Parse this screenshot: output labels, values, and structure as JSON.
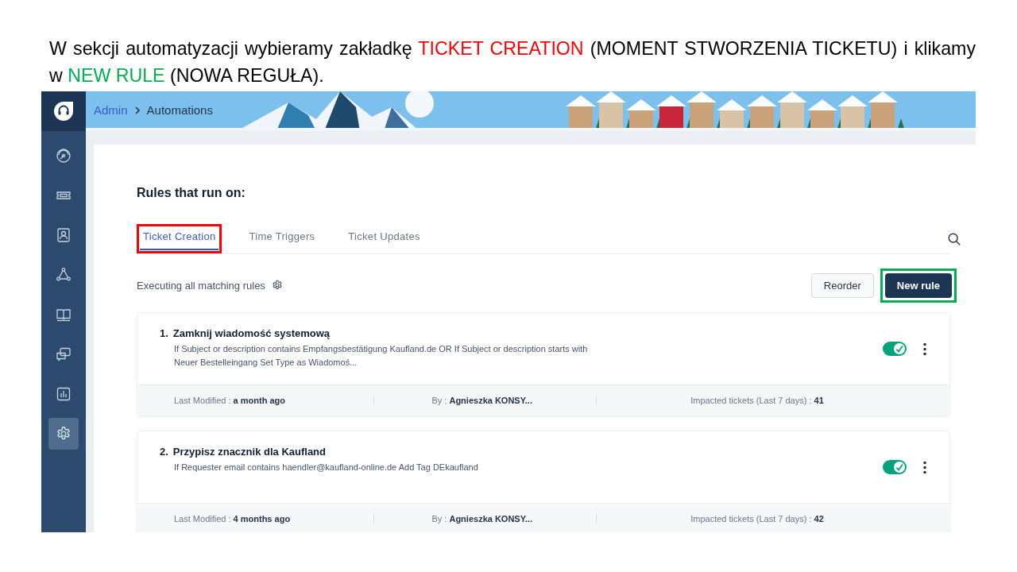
{
  "caption": {
    "segments": [
      {
        "text": "W sekcji automatyzacji wybieramy zakładkę ",
        "color": "#000000"
      },
      {
        "text": "TICKET CREATION",
        "color": "#ff0000"
      },
      {
        "text": " (MOMENT STWORZENIA TICKETU)  i klikamy w ",
        "color": "#000000"
      },
      {
        "text": "NEW RULE",
        "color": "#00b050"
      },
      {
        "text": " (NOWA REGUŁA).",
        "color": "#000000"
      }
    ]
  },
  "breadcrumb": {
    "parent": "Admin",
    "current": "Automations"
  },
  "sidebar": {
    "items": [
      {
        "selected": false
      },
      {
        "selected": false
      },
      {
        "selected": false
      },
      {
        "selected": false
      },
      {
        "selected": false
      },
      {
        "selected": false
      },
      {
        "selected": false
      },
      {
        "selected": true
      }
    ]
  },
  "heading": "Rules that run on:",
  "tabs": [
    {
      "label": "Ticket Creation",
      "selected": true
    },
    {
      "label": "Time Triggers",
      "selected": false
    },
    {
      "label": "Ticket Updates",
      "selected": false
    }
  ],
  "execution_mode": "Executing all matching rules",
  "buttons": {
    "reorder": "Reorder",
    "new_rule": "New rule"
  },
  "rules": [
    {
      "number": "1.",
      "title": "Zamknij wiadomość systemową",
      "description": "If Subject or description contains Empfangsbestätigung Kaufland.de OR If Subject or description starts with Neuer Bestelleingang Set Type as Wiadomoś...",
      "enabled": true,
      "last_modified": "Last Modified : **a month ago**",
      "by": "By : **Agnieszka KONSY...**",
      "impacted": "Impacted tickets (Last 7 days) : **41**"
    },
    {
      "number": "2.",
      "title": "Przypisz znacznik dla Kaufland",
      "description": "If Requester email contains haendler@kaufland-online.de Add Tag DEkaufland",
      "enabled": true,
      "last_modified": "Last Modified : **4 months ago**",
      "by": "By : **Agnieszka KONSY...**",
      "impacted": "Impacted tickets (Last 7 days) : **42**"
    }
  ]
}
